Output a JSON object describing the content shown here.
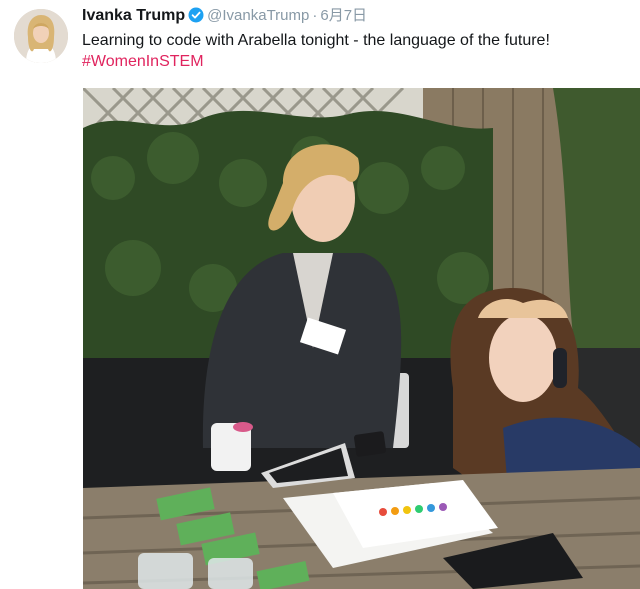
{
  "tweet": {
    "display_name": "Ivanka Trump",
    "verified_icon": "verified-badge-icon",
    "handle": "@IvankaTrump",
    "separator": "·",
    "date": "6月7日",
    "text": "Learning to code with Arabella tonight - the language of the future!",
    "hashtag": "#WomenInSTEM",
    "accent_color": "#e0245e",
    "verified_color": "#1da1f2",
    "media": {
      "type": "photo",
      "icon": "photo"
    }
  }
}
